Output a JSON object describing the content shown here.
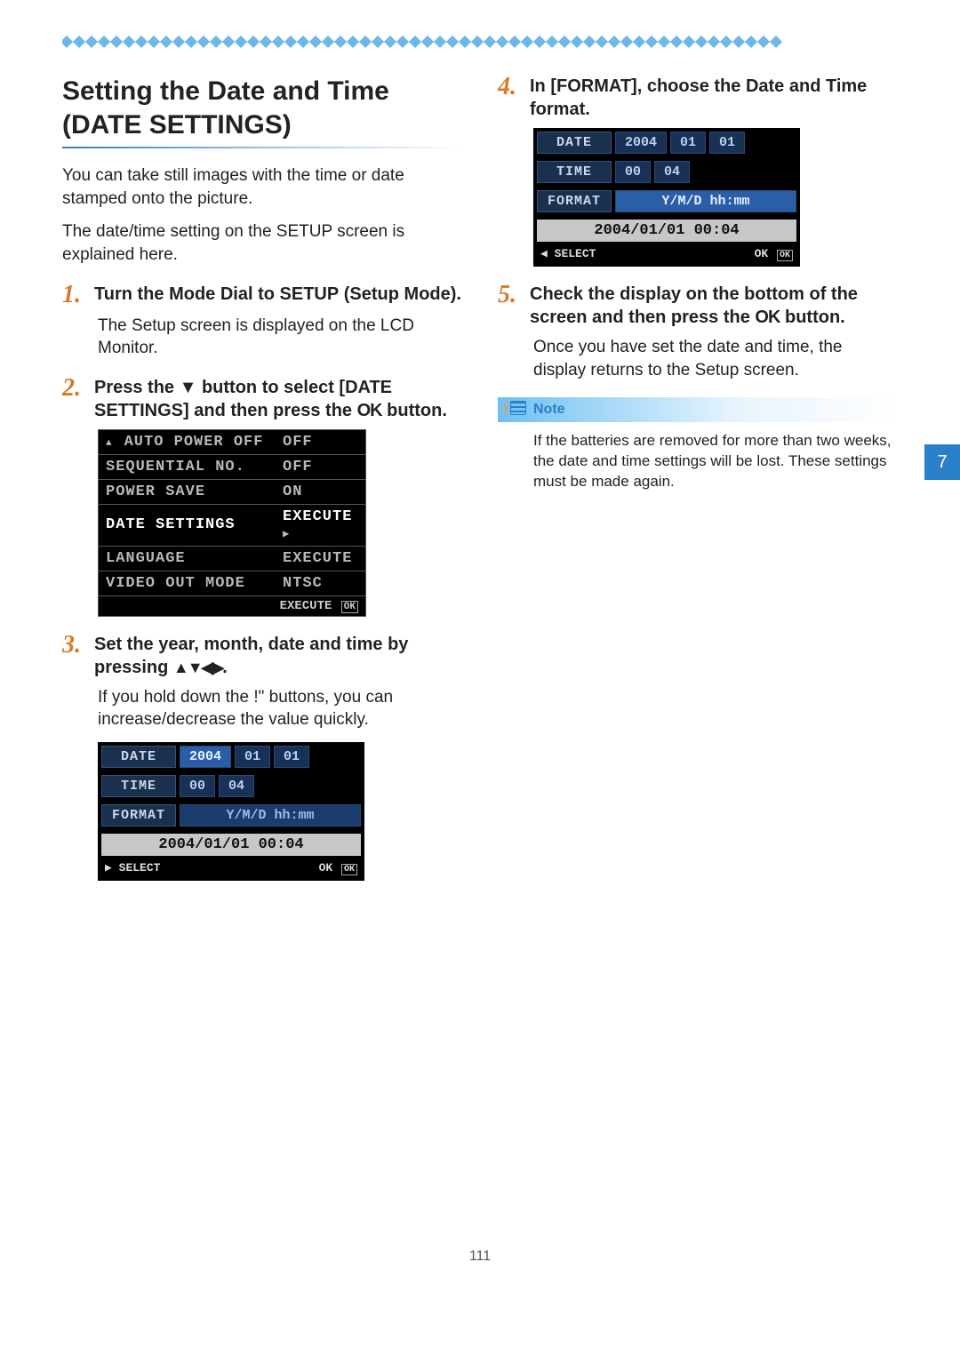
{
  "header": {
    "title": "Setting the Date and Time (DATE SETTINGS)"
  },
  "intro": {
    "p1": "You can take still images with the time or date stamped onto the picture.",
    "p2": "The date/time setting on the SETUP screen is explained here."
  },
  "steps": {
    "s1": {
      "num": "1.",
      "head_a": "Turn the Mode Dial to ",
      "head_setup": "SETUP",
      "head_b": " (Setup Mode).",
      "body": "The Setup screen is displayed on the LCD Monitor."
    },
    "s2": {
      "num": "2.",
      "head_a": "Press the ",
      "head_arrow": "▼",
      "head_b": " button to select [DATE SETTINGS] and then press the ",
      "head_ok": "OK",
      "head_c": " button."
    },
    "s3": {
      "num": "3.",
      "head_a": "Set the year, month, date and time by pressing ",
      "head_arrows": "▲▼◀▶",
      "head_b": ".",
      "body": "If you hold down the !\" buttons, you can increase/decrease the value quickly."
    },
    "s4": {
      "num": "4.",
      "head": "In [FORMAT], choose the Date and Time format."
    },
    "s5": {
      "num": "5.",
      "head_a": "Check the display on the bottom of the screen and then press the ",
      "head_ok": "OK",
      "head_b": "  button.",
      "body": "Once you have set the date and time, the display returns to the Setup screen."
    }
  },
  "setup_menu": {
    "rows": [
      {
        "label": "AUTO POWER OFF",
        "value": "OFF"
      },
      {
        "label": "SEQUENTIAL NO.",
        "value": "OFF"
      },
      {
        "label": "POWER SAVE",
        "value": "ON"
      },
      {
        "label": "DATE SETTINGS",
        "value": "EXECUTE"
      },
      {
        "label": "LANGUAGE",
        "value": "EXECUTE"
      },
      {
        "label": "VIDEO OUT MODE",
        "value": "NTSC"
      }
    ],
    "footer_execute": "EXECUTE",
    "footer_ok": "OK"
  },
  "date_screen_a": {
    "date_label": "DATE",
    "year": "2004",
    "month": "01",
    "day": "01",
    "time_label": "TIME",
    "hh": "00",
    "mm": "04",
    "format_label": "FORMAT",
    "format_value": "Y/M/D hh:mm",
    "preview": "2004/01/01 00:04",
    "select": "SELECT",
    "ok": "OK",
    "okbox": "OK",
    "select_glyph": "▶"
  },
  "date_screen_b": {
    "date_label": "DATE",
    "year": "2004",
    "month": "01",
    "day": "01",
    "time_label": "TIME",
    "hh": "00",
    "mm": "04",
    "format_label": "FORMAT",
    "format_value": "Y/M/D hh:mm",
    "preview": "2004/01/01 00:04",
    "select": "SELECT",
    "ok": "OK",
    "okbox": "OK",
    "select_glyph": "◀"
  },
  "note": {
    "label": "Note",
    "text": "If the batteries are removed for more than two weeks, the date and time settings will be lost. These settings must be made again."
  },
  "side_tab": "7",
  "page_number": "111"
}
